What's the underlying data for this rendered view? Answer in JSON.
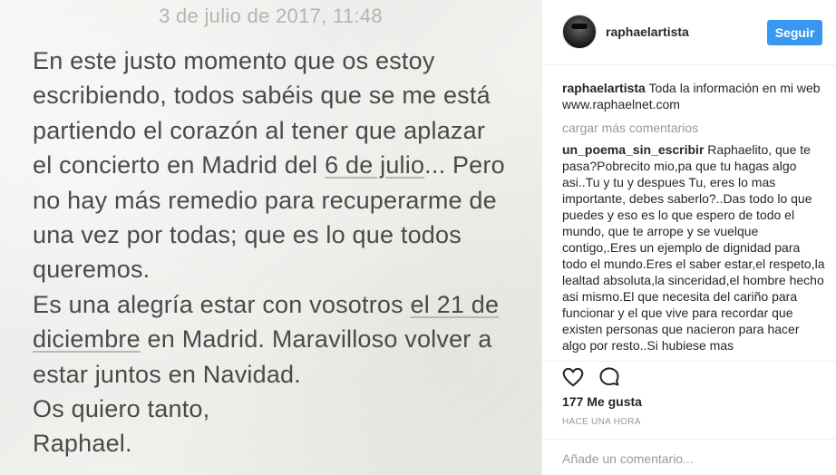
{
  "note": {
    "date": "3 de julio de 2017, 11:48",
    "lines": [
      "En este justo momento que os estoy",
      "escribiendo, todos sabéis que se me está",
      "partiendo el corazón al tener que aplazar",
      {
        "before": "el concierto en Madrid del ",
        "link": "6 de julio",
        "after": "... Pero"
      },
      "no hay más remedio para recuperarme de",
      "una vez por todas; que es lo que todos",
      "queremos.",
      {
        "before": "Es una alegría estar con vosotros ",
        "link": "el 21 de",
        "after": ""
      },
      {
        "before": "",
        "link": "diciembre",
        "after": " en Madrid. Maravilloso volver a"
      },
      "estar juntos en Navidad.",
      "Os quiero tanto,",
      "Raphael."
    ]
  },
  "header": {
    "username": "raphaelartista",
    "follow_label": "Seguir"
  },
  "caption": {
    "username": "raphaelartista",
    "text": "Toda la información en mi web www.raphaelnet.com"
  },
  "load_more": "cargar más comentarios",
  "comments": [
    {
      "username": "un_poema_sin_escribir",
      "text": "Raphaelito, que te pasa?Pobrecito mio,pa que tu hagas algo asi..Tu y tu y despues Tu, eres lo mas importante, debes saberlo?..Das todo lo que puedes y eso es lo que espero de todo el mundo, que te arrope y se vuelque contigo,.Eres un ejemplo de dignidad para todo el mundo.Eres el saber estar,el respeto,la lealtad absoluta,la sinceridad,el hombre hecho asi mismo.El que necesita del cariño para funcionar y el que vive para recordar que existen personas que nacieron para hacer algo por resto..Si hubiese mas"
    }
  ],
  "icons": {
    "like": "heart-icon",
    "comment": "comment-bubble-icon"
  },
  "likes": "177 Me gusta",
  "time_ago": "HACE UNA HORA",
  "add_comment": {
    "placeholder": "Añade un comentario..."
  },
  "colors": {
    "follow_bg": "#3897f0",
    "username": "#262626",
    "muted": "#999999",
    "note_text": "#4a4a48"
  }
}
